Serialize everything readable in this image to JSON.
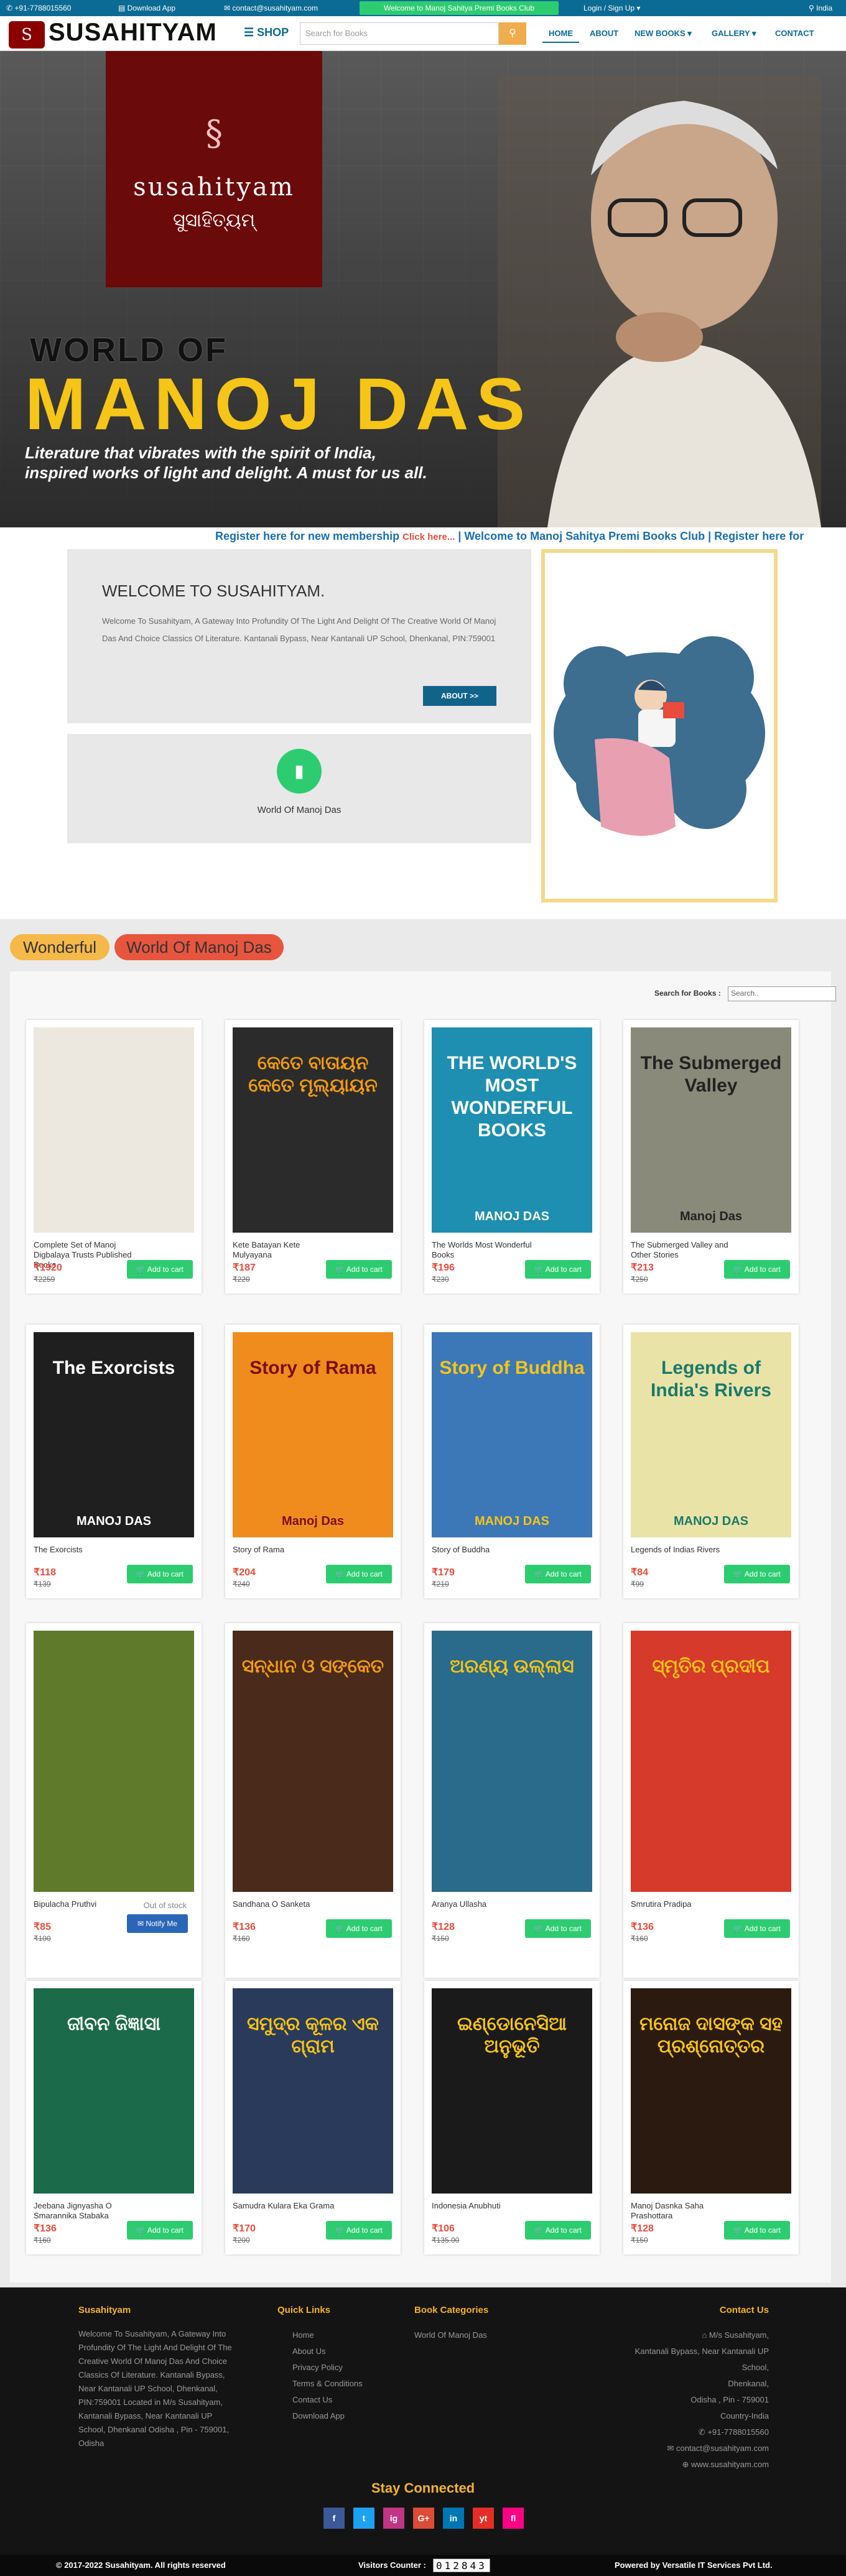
{
  "topbar": {
    "phone": "+91-7788015560",
    "download": "Download App",
    "email": "contact@susahityam.com",
    "club": "Welcome to Manoj Sahitya Premi Books Club",
    "login": "Login / Sign Up",
    "country": "India"
  },
  "header": {
    "logo_text": "SUSAHITYAM",
    "shop": "SHOP",
    "search_placeholder": "Search for Books",
    "nav": [
      "HOME",
      "ABOUT",
      "NEW BOOKS",
      "GALLERY",
      "CONTACT"
    ]
  },
  "hero": {
    "brand_latin": "susahityam",
    "brand_odia": "ସୁସାହିତ୍ୟମ୍",
    "world_of": "WORLD OF",
    "name": "MANOJ DAS",
    "tagline_1": "Literature that vibrates with the spirit of India,",
    "tagline_2": "inspired works of light and delight. A must for us all."
  },
  "marquee": {
    "part1": "Register here for new membership",
    "click": "Click here...",
    "part2": "| Welcome to Manoj Sahitya Premi Books Club | Register here for"
  },
  "welcome": {
    "title": "WELCOME TO SUSAHITYAM.",
    "text": "Welcome To Susahityam, A Gateway Into Profundity Of The Light And Delight Of The Creative World Of Manoj Das And Choice Classics Of Literature. Kantanali Bypass, Near Kantanali UP School, Dhenkanal, PIN:759001",
    "about_btn": "ABOUT >>"
  },
  "category_box": {
    "label": "World Of Manoj Das"
  },
  "tabs": [
    "Wonderful",
    "World Of Manoj Das"
  ],
  "search_books": {
    "label": "Search for Books :",
    "placeholder": "Search.."
  },
  "products": [
    {
      "name": "Complete Set of Manoj Digbalaya Trusts Published Books",
      "price": "₹1920",
      "old": "₹2259",
      "cover_bg": "#ece7df",
      "cover_fg": "#333",
      "cover_title": "",
      "cover_author": ""
    },
    {
      "name": "Kete Batayan Kete Mulyayana",
      "price": "₹187",
      "old": "₹220",
      "cover_bg": "#2b2b2b",
      "cover_fg": "#f39c12",
      "cover_title": "କେତେ ବାତାୟନ କେତେ ମୂଲ୍ୟାୟନ",
      "cover_author": ""
    },
    {
      "name": "The Worlds Most Wonderful Books",
      "price": "₹196",
      "old": "₹230",
      "cover_bg": "#1e8fb0",
      "cover_fg": "#fff",
      "cover_title": "THE WORLD'S MOST WONDERFUL BOOKS",
      "cover_author": "MANOJ DAS"
    },
    {
      "name": "The Submerged Valley and Other Stories",
      "price": "₹213",
      "old": "₹250",
      "cover_bg": "#8a8a7a",
      "cover_fg": "#222",
      "cover_title": "The Submerged Valley",
      "cover_author": "Manoj Das"
    },
    {
      "name": "The Exorcists",
      "price": "₹118",
      "old": "₹139",
      "cover_bg": "#1f1f1f",
      "cover_fg": "#fff",
      "cover_title": "The Exorcists",
      "cover_author": "MANOJ DAS"
    },
    {
      "name": "Story of Rama",
      "price": "₹204",
      "old": "₹240",
      "cover_bg": "#f08c1d",
      "cover_fg": "#7a1010",
      "cover_title": "Story of Rama",
      "cover_author": "Manoj Das"
    },
    {
      "name": "Story of Buddha",
      "price": "₹179",
      "old": "₹210",
      "cover_bg": "#3c77b8",
      "cover_fg": "#f5c518",
      "cover_title": "Story of Buddha",
      "cover_author": "MANOJ DAS"
    },
    {
      "name": "Legends of Indias Rivers",
      "price": "₹84",
      "old": "₹99",
      "cover_bg": "#e9e3a8",
      "cover_fg": "#1b7a6a",
      "cover_title": "Legends of India's Rivers",
      "cover_author": "MANOJ DAS"
    },
    {
      "name": "Bipulacha Pruthvi",
      "price": "₹85",
      "old": "₹100",
      "cover_bg": "#5f7a2a",
      "cover_fg": "#fff",
      "cover_title": "",
      "cover_author": "",
      "out_of_stock": "Out of stock",
      "notify": "Notify Me"
    },
    {
      "name": "Sandhana O Sanketa",
      "price": "₹136",
      "old": "₹160",
      "cover_bg": "#4a2a1a",
      "cover_fg": "#f39c12",
      "cover_title": "ସନ୍ଧାନ ଓ ସଙ୍କେତ",
      "cover_author": ""
    },
    {
      "name": "Aranya Ullasha",
      "price": "₹128",
      "old": "₹150",
      "cover_bg": "#2a6a8a",
      "cover_fg": "#f5c518",
      "cover_title": "ଅରଣ୍ୟ ଉଲ୍ଲାସ",
      "cover_author": ""
    },
    {
      "name": "Smrutira Pradipa",
      "price": "₹136",
      "old": "₹160",
      "cover_bg": "#d63a2a",
      "cover_fg": "#f5c518",
      "cover_title": "ସ୍ମୃତିର ପ୍ରଦୀପ",
      "cover_author": ""
    },
    {
      "name": "Jeebana Jignyasha O Smarannika Stabaka",
      "price": "₹136",
      "old": "₹160",
      "cover_bg": "#1b6a4a",
      "cover_fg": "#fff",
      "cover_title": "ଜୀବନ ଜିଜ୍ଞାସା",
      "cover_author": ""
    },
    {
      "name": "Samudra Kulara Eka Grama",
      "price": "₹170",
      "old": "₹200",
      "cover_bg": "#2a3a5a",
      "cover_fg": "#f5c518",
      "cover_title": "ସମୁଦ୍ର କୂଳର ଏକ ଗ୍ରାମ",
      "cover_author": ""
    },
    {
      "name": "Indonesia Anubhuti",
      "price": "₹106",
      "old": "₹135.00",
      "cover_bg": "#1a1a1a",
      "cover_fg": "#f5c518",
      "cover_title": "ଇଣ୍ଡୋନେସିଆ ଅନୁଭୂତି",
      "cover_author": ""
    },
    {
      "name": "Manoj Dasnka Saha Prashottara",
      "price": "₹128",
      "old": "₹150",
      "cover_bg": "#2a1a10",
      "cover_fg": "#f5c518",
      "cover_title": "ମନୋଜ ଦାସଙ୍କ ସହ ପ୍ରଶ୍ନୋତ୍ତର",
      "cover_author": ""
    }
  ],
  "add_to_cart": "Add to cart",
  "footer": {
    "col1_title": "Susahityam",
    "col1_text": "Welcome To Susahityam, A Gateway Into Profundity Of The Light And Delight Of The Creative World Of Manoj Das And Choice Classics Of Literature. Kantanali Bypass, Near Kantanali UP School, Dhenkanal, PIN:759001 Located in M/s Susahityam, Kantanali Bypass, Near Kantanali UP School, Dhenkanal Odisha , Pin - 759001, Odisha",
    "col2_title": "Quick Links",
    "col2_links": [
      "Home",
      "About Us",
      "Privacy Policy",
      "Terms & Conditions",
      "Contact Us",
      "Download App"
    ],
    "col3_title": "Book Categories",
    "col3_links": [
      "World Of Manoj Das"
    ],
    "col4_title": "Contact Us",
    "col4_lines": [
      "M/s Susahityam,",
      "Kantanali Bypass, Near Kantanali UP School,",
      "Dhenkanal,",
      "Odisha , Pin - 759001",
      "Country-India",
      "+91-7788015560",
      "contact@susahityam.com",
      "www.susahityam.com"
    ],
    "stay": "Stay Connected",
    "social": [
      "f",
      "t",
      "ig",
      "G+",
      "in",
      "yt",
      "fl"
    ]
  },
  "bottom": {
    "copyright": "© 2017-2022 Susahityam. All rights reserved",
    "visitors_label": "Visitors Counter :",
    "visitors": "012843",
    "powered": "Powered by Versatile IT Services Pvt Ltd."
  },
  "colors": {
    "topbar": "#0c6b95",
    "accent_green": "#2ecc71",
    "price_red": "#e74c3c",
    "footer_gold": "#f0b429"
  }
}
